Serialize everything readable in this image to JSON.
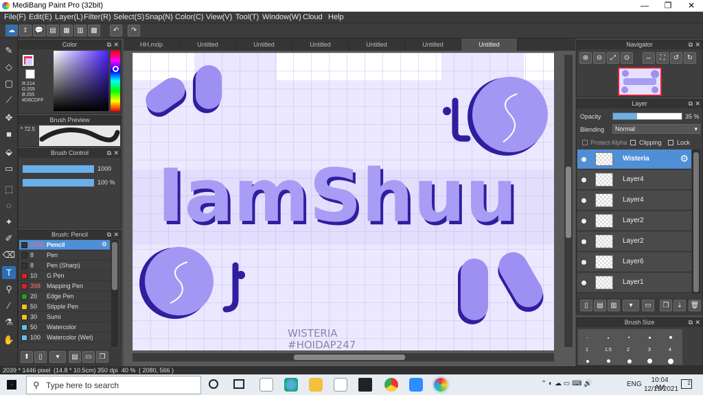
{
  "app": {
    "title": "MediBang Paint Pro (32bit)"
  },
  "menu": [
    "File(F)",
    "Edit(E)",
    "Layer(L)",
    "Filter(R)",
    "Select(S)",
    "Snap(N)",
    "Color(C)",
    "View(V)",
    "Tool(T)",
    "Window(W)",
    "Cloud",
    "Help"
  ],
  "tabs": [
    "HH.mdp",
    "Untitled",
    "Untitled",
    "Untitled",
    "Untitled",
    "Untitled",
    "Untitled"
  ],
  "color_panel": {
    "title": "Color",
    "r": "R:214",
    "g": "G:205",
    "b": "B:255",
    "hex": "#D6CDFF",
    "main_color": "#d6cdff"
  },
  "brush_preview": {
    "title": "Brush Preview",
    "size": "* 72.5"
  },
  "brush_control": {
    "title": "Brush Control",
    "size": "1000",
    "opacity": "100 %"
  },
  "brush_list": {
    "title": "Brush: Pencil",
    "items": [
      {
        "size": "1000",
        "name": "Pencil",
        "color": "#333333",
        "active": true
      },
      {
        "size": "8",
        "name": "Pen",
        "color": "#333333"
      },
      {
        "size": "8",
        "name": "Pen (Sharp)",
        "color": "#333333"
      },
      {
        "size": "10",
        "name": "G Pen",
        "color": "#e02020"
      },
      {
        "size": "398",
        "name": "Mapping Pen",
        "color": "#e02020"
      },
      {
        "size": "20",
        "name": "Edge Pen",
        "color": "#20a020"
      },
      {
        "size": "50",
        "name": "Stipple Pen",
        "color": "#f0c020"
      },
      {
        "size": "30",
        "name": "Sumi",
        "color": "#f0c020"
      },
      {
        "size": "50",
        "name": "Watercolor",
        "color": "#60c0f0"
      },
      {
        "size": "100",
        "name": "Watercolor (Wet)",
        "color": "#60c0f0"
      }
    ]
  },
  "navigator": {
    "title": "Navigator"
  },
  "layer_panel": {
    "title": "Layer",
    "opacity_label": "Opacity",
    "opacity_value": "35 %",
    "opacity_fraction": 0.35,
    "blending_label": "Blending",
    "blending_value": "Normal",
    "protect_alpha": "Protect Alpha",
    "clipping": "Clipping",
    "lock": "Lock",
    "layers": [
      "Wisteria",
      "Layer4",
      "Layer4",
      "Layer2",
      "Layer2",
      "Layer6",
      "Layer1"
    ]
  },
  "brush_size": {
    "title": "Brush Size",
    "values": [
      "1",
      "1.5",
      "2",
      "3",
      "4"
    ]
  },
  "canvas": {
    "headline": "IamShuu",
    "watermark1": "WISTERIA",
    "watermark2": "#HOIDAP247"
  },
  "statusbar": {
    "size": "2039 * 1446 pixel",
    "cm": "(14.8 * 10.5cm)",
    "dpi": "350 dpi",
    "zoom": "40 %",
    "coords": "( 2080, 566 )"
  },
  "taskbar": {
    "search_placeholder": "Type here to search",
    "time": "10:04 AM",
    "date": "12/15/2021",
    "lang": "ENG",
    "notif": "2"
  }
}
